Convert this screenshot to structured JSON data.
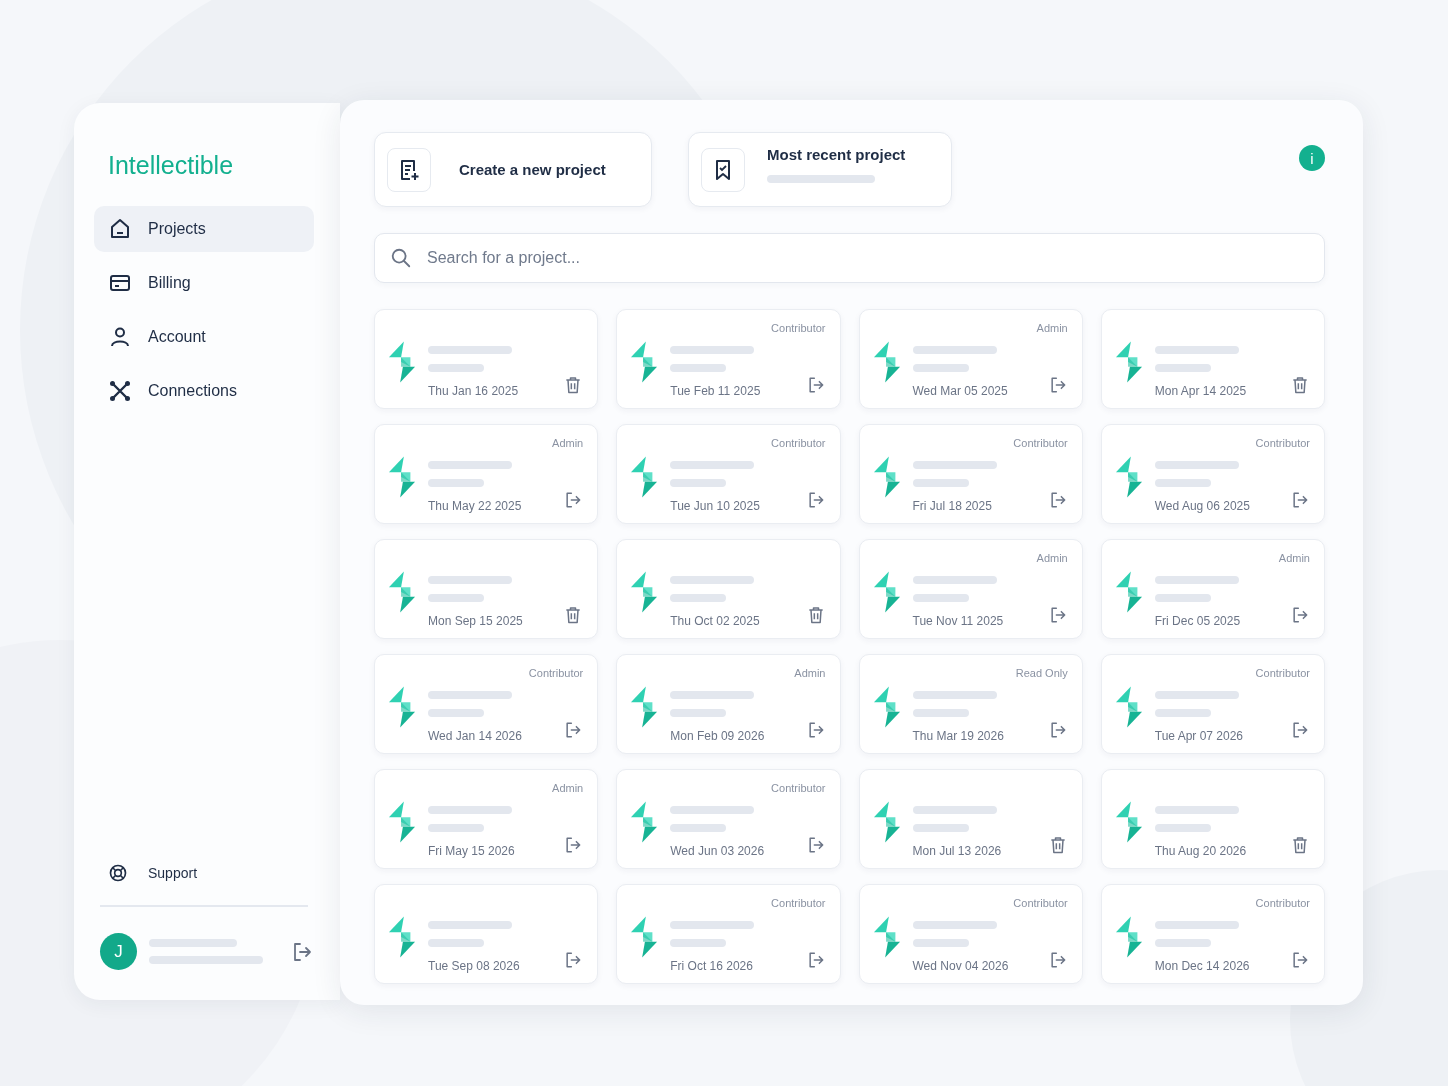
{
  "sidebar": {
    "logo": "Intellectible",
    "items": [
      {
        "label": "Projects",
        "kind": "home",
        "selected": true
      },
      {
        "label": "Billing",
        "kind": "card",
        "selected": false
      },
      {
        "label": "Account",
        "kind": "user",
        "selected": false
      },
      {
        "label": "Connections",
        "kind": "network",
        "selected": false
      }
    ],
    "support": "Support",
    "user": {
      "initial": "J"
    }
  },
  "actions": {
    "create": "Create a new project",
    "recent": "Most recent project"
  },
  "info": "i",
  "search": {
    "placeholder": "Search for a project..."
  },
  "projects": [
    {
      "date": "Thu Jan 16 2025",
      "kind": "delete"
    },
    {
      "date": "Tue Feb 11 2025",
      "role": "Contributor",
      "kind": "leave"
    },
    {
      "date": "Wed Mar 05 2025",
      "role": "Admin",
      "kind": "leave"
    },
    {
      "date": "Mon Apr 14 2025",
      "kind": "delete"
    },
    {
      "date": "Thu May 22 2025",
      "role": "Admin",
      "kind": "leave"
    },
    {
      "date": "Tue Jun 10 2025",
      "role": "Contributor",
      "kind": "leave"
    },
    {
      "date": "Fri Jul 18 2025",
      "role": "Contributor",
      "kind": "leave"
    },
    {
      "date": "Wed Aug 06 2025",
      "role": "Contributor",
      "kind": "leave"
    },
    {
      "date": "Mon Sep 15 2025",
      "kind": "delete"
    },
    {
      "date": "Thu Oct 02 2025",
      "kind": "delete"
    },
    {
      "date": "Tue Nov 11 2025",
      "role": "Admin",
      "kind": "leave"
    },
    {
      "date": "Fri Dec 05 2025",
      "role": "Admin",
      "kind": "leave"
    },
    {
      "date": "Wed Jan 14 2026",
      "role": "Contributor",
      "kind": "leave"
    },
    {
      "date": "Mon Feb 09 2026",
      "role": "Admin",
      "kind": "leave"
    },
    {
      "date": "Thu Mar 19 2026",
      "role": "Read Only",
      "kind": "leave"
    },
    {
      "date": "Tue Apr 07 2026",
      "role": "Contributor",
      "kind": "leave"
    },
    {
      "date": "Fri May 15 2026",
      "role": "Admin",
      "kind": "leave"
    },
    {
      "date": "Wed Jun 03 2026",
      "role": "Contributor",
      "kind": "leave"
    },
    {
      "date": "Mon Jul 13 2026",
      "kind": "delete"
    },
    {
      "date": "Thu Aug 20 2026",
      "kind": "delete"
    },
    {
      "date": "Tue Sep 08 2026",
      "kind": "leave"
    },
    {
      "date": "Fri Oct 16 2026",
      "role": "Contributor",
      "kind": "leave"
    },
    {
      "date": "Wed Nov 04 2026",
      "role": "Contributor",
      "kind": "leave"
    },
    {
      "date": "Mon Dec 14 2026",
      "role": "Contributor",
      "kind": "leave"
    }
  ]
}
